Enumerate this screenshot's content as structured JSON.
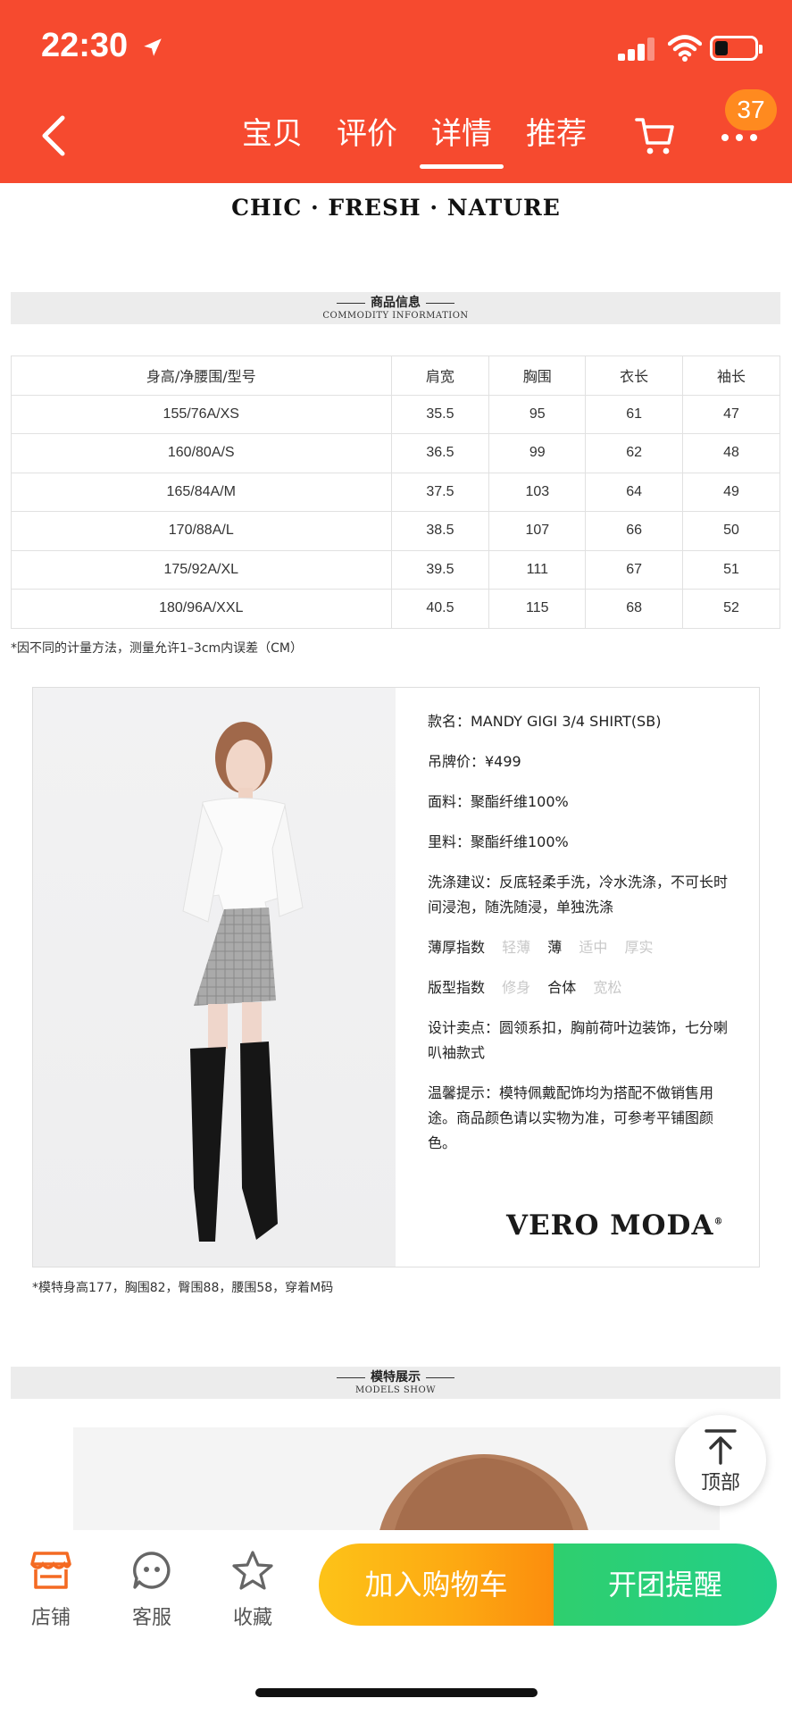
{
  "status": {
    "time": "22:30"
  },
  "header": {
    "tabs": [
      "宝贝",
      "评价",
      "详情",
      "推荐"
    ],
    "active_tab": 2,
    "cart_badge": "37"
  },
  "slogan": "CHIC · FRESH · NATURE",
  "commodity_section": {
    "title": "商品信息",
    "subtitle": "COMMODITY INFORMATION"
  },
  "size_table": {
    "headers": [
      "身高/净腰围/型号",
      "肩宽",
      "胸围",
      "衣长",
      "袖长"
    ],
    "rows": [
      [
        "155/76A/XS",
        "35.5",
        "95",
        "61",
        "47"
      ],
      [
        "160/80A/S",
        "36.5",
        "99",
        "62",
        "48"
      ],
      [
        "165/84A/M",
        "37.5",
        "103",
        "64",
        "49"
      ],
      [
        "170/88A/L",
        "38.5",
        "107",
        "66",
        "50"
      ],
      [
        "175/92A/XL",
        "39.5",
        "111",
        "67",
        "51"
      ],
      [
        "180/96A/XXL",
        "40.5",
        "115",
        "68",
        "52"
      ]
    ],
    "note": "*因不同的计量方法，测量允许1–3cm内误差（CM）"
  },
  "product_info": {
    "style_name": "款名：MANDY GIGI 3/4 SHIRT(SB)",
    "tag_price": "吊牌价：¥499",
    "fabric": "面料：聚酯纤维100%",
    "lining": "里料：聚酯纤维100%",
    "washing": "洗涤建议：反底轻柔手洗，冷水洗涤，不可长时间浸泡，随洗随浸，单独洗涤",
    "thickness": {
      "label": "薄厚指数",
      "options": [
        "轻薄",
        "薄",
        "适中",
        "厚实"
      ],
      "selected": 1
    },
    "fit": {
      "label": "版型指数",
      "options": [
        "修身",
        "合体",
        "宽松"
      ],
      "selected": 1
    },
    "design": "设计卖点：圆领系扣，胸前荷叶边装饰，七分喇叭袖款式",
    "reminder": "温馨提示：模特佩戴配饰均为搭配不做销售用途。商品颜色请以实物为准，可参考平铺图颜色。",
    "brand": "VERO MODA"
  },
  "model_note": "*模特身高177，胸围82，臀围88，腰围58，穿着M码",
  "models_section": {
    "title": "模特展示",
    "subtitle": "MODELS SHOW"
  },
  "back_to_top": "顶部",
  "bottom_bar": {
    "store": "店铺",
    "service": "客服",
    "favorite": "收藏",
    "add_to_cart": "加入购物车",
    "group_reminder": "开团提醒"
  },
  "colors": {
    "header_red": "#f64a2f",
    "cart_orange": "#fda812",
    "group_green": "#22cf88",
    "badge_orange": "#ff8a1f"
  }
}
